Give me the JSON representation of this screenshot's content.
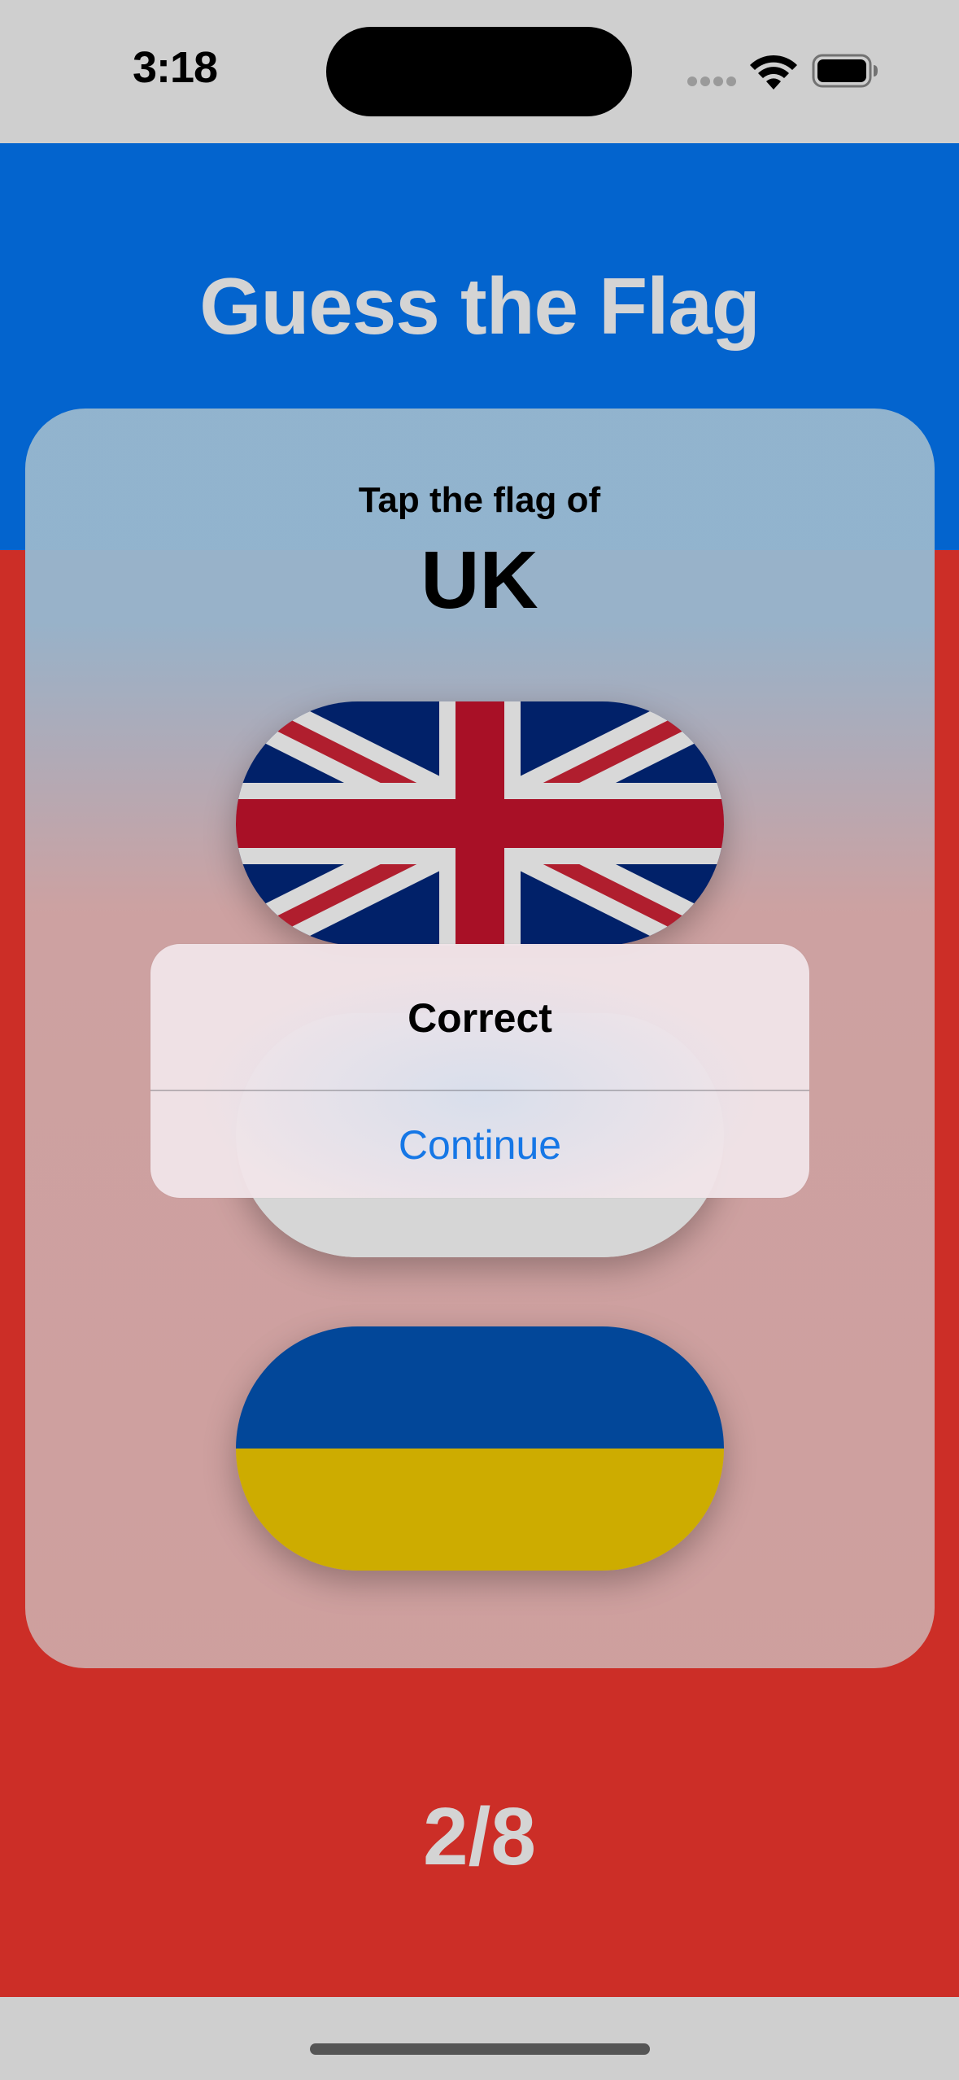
{
  "status_bar": {
    "time": "3:18"
  },
  "app": {
    "title": "Guess the Flag",
    "prompt": "Tap the flag of",
    "country": "UK",
    "score": "2/8",
    "colors": {
      "background_top": "#0364ce",
      "background_bottom": "#cc2e27",
      "accent": "#1677e6"
    }
  },
  "flags": [
    {
      "icon": "uk-flag"
    },
    {
      "icon": "blank-flag"
    },
    {
      "icon": "ukraine-flag"
    }
  ],
  "alert": {
    "title": "Correct",
    "button_label": "Continue"
  }
}
